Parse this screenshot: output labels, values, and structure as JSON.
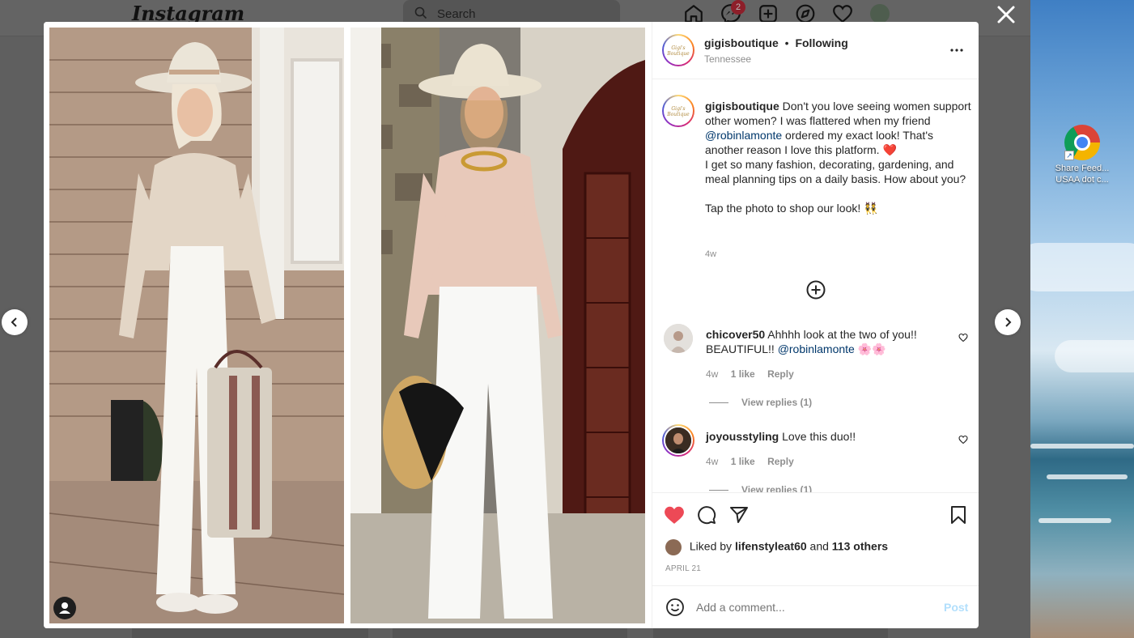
{
  "instagram": {
    "logo": "Instagram",
    "search_placeholder": "Search",
    "messenger_badge": "2"
  },
  "desktop": {
    "icon_label_line1": "Share Feed...",
    "icon_label_line2": "USAA dot c..."
  },
  "post": {
    "author": "gigisboutique",
    "follow_status": "Following",
    "separator": "•",
    "location": "Tennessee",
    "caption_line1": "Don't you love seeing women support other women? I was flattered when my friend",
    "caption_mention": "@robinlamonte",
    "caption_line2": "ordered my exact look! That's another reason I love this platform.",
    "caption_emoji": "❤️",
    "caption_line3": "I get so many fashion, decorating, gardening, and meal planning tips on a daily basis. How about you?",
    "caption_line4": "Tap the photo to shop our look!",
    "caption_line4_emoji": "👯",
    "caption_age": "4w",
    "likes_prefix": "Liked by",
    "liked_by_user": "lifenstyleat60",
    "likes_and": "and",
    "likes_others": "113 others",
    "date": "APRIL 21",
    "comment_placeholder": "Add a comment...",
    "post_button": "Post"
  },
  "comments": [
    {
      "user": "chicover50",
      "text": "Ahhhh look at the two of you!! BEAUTIFUL!!",
      "mention": "@robinlamonte",
      "emoji": "🌸🌸",
      "age": "4w",
      "likes": "1 like",
      "reply": "Reply",
      "view_replies": "View replies (1)"
    },
    {
      "user": "joyousstyling",
      "text": "Love this duo!!",
      "mention": "",
      "emoji": "",
      "age": "4w",
      "likes": "1 like",
      "reply": "Reply",
      "view_replies": "View replies (1)"
    }
  ],
  "colors": {
    "like_red": "#ed4956",
    "link_blue": "#00376b",
    "post_button": "#b2dffc"
  },
  "icons": [
    "close-icon",
    "chevron-left-icon",
    "chevron-right-icon",
    "more-icon",
    "add-circle-icon",
    "heart-icon",
    "comment-icon",
    "share-icon",
    "bookmark-icon",
    "emoji-icon",
    "user-tag-icon"
  ]
}
